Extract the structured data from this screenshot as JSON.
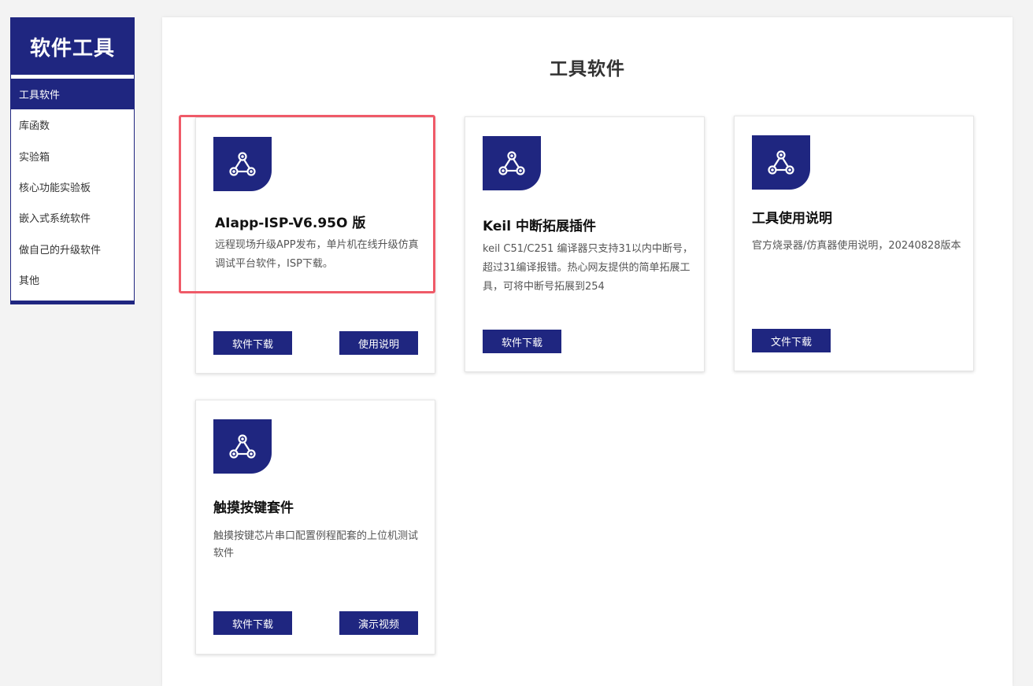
{
  "sidebar": {
    "title": "软件工具",
    "items": [
      {
        "label": "工具软件",
        "active": true
      },
      {
        "label": "库函数"
      },
      {
        "label": "实验箱"
      },
      {
        "label": "核心功能实验板"
      },
      {
        "label": "嵌入式系统软件"
      },
      {
        "label": "做自己的升级软件"
      },
      {
        "label": "其他"
      }
    ]
  },
  "main": {
    "title": "工具软件",
    "cards": [
      {
        "title": "AIapp-ISP-V6.95O 版",
        "desc": "远程现场升级APP发布，单片机在线升级仿真调试平台软件，ISP下载。",
        "buttons": [
          "软件下载",
          "使用说明"
        ],
        "highlighted": true
      },
      {
        "title": "Keil 中断拓展插件",
        "desc": "keil C51/C251 编译器只支持31以内中断号，超过31编译报错。热心网友提供的简单拓展工具，可将中断号拓展到254",
        "buttons": [
          "软件下载"
        ]
      },
      {
        "title": "工具使用说明",
        "desc": "官方烧录器/仿真器使用说明，20240828版本",
        "buttons": [
          "文件下载"
        ]
      },
      {
        "title": "触摸按键套件",
        "desc": "触摸按键芯片串口配置例程配套的上位机测试软件",
        "buttons": [
          "软件下载",
          "演示视频"
        ]
      }
    ]
  },
  "colors": {
    "brand": "#1f2680",
    "highlight": "#ef5a68",
    "background": "#f3f3f3"
  },
  "icons": {
    "card_icon": "share-network-icon"
  }
}
